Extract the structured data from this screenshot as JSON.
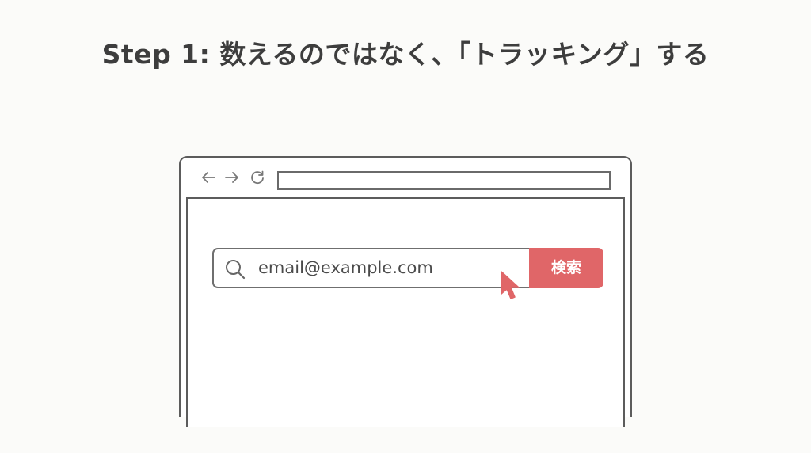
{
  "header": {
    "title": "Step 1: 数えるのではなく、「トラッキング」する"
  },
  "browser": {
    "toolbar": {
      "icons": [
        "arrow-left-icon",
        "arrow-right-icon",
        "reload-icon"
      ]
    },
    "address_bar": {
      "value": ""
    },
    "search": {
      "icon": "search-icon",
      "value": "email@example.com",
      "button_label": "検索",
      "button_color": "#e06668"
    },
    "cursor": {
      "icon": "mouse-pointer-icon",
      "color": "#e06668"
    }
  },
  "colors": {
    "background": "#fbfbf9",
    "title_text": "#3d3d3d",
    "outline": "#5c5c5c",
    "accent": "#e06668"
  }
}
